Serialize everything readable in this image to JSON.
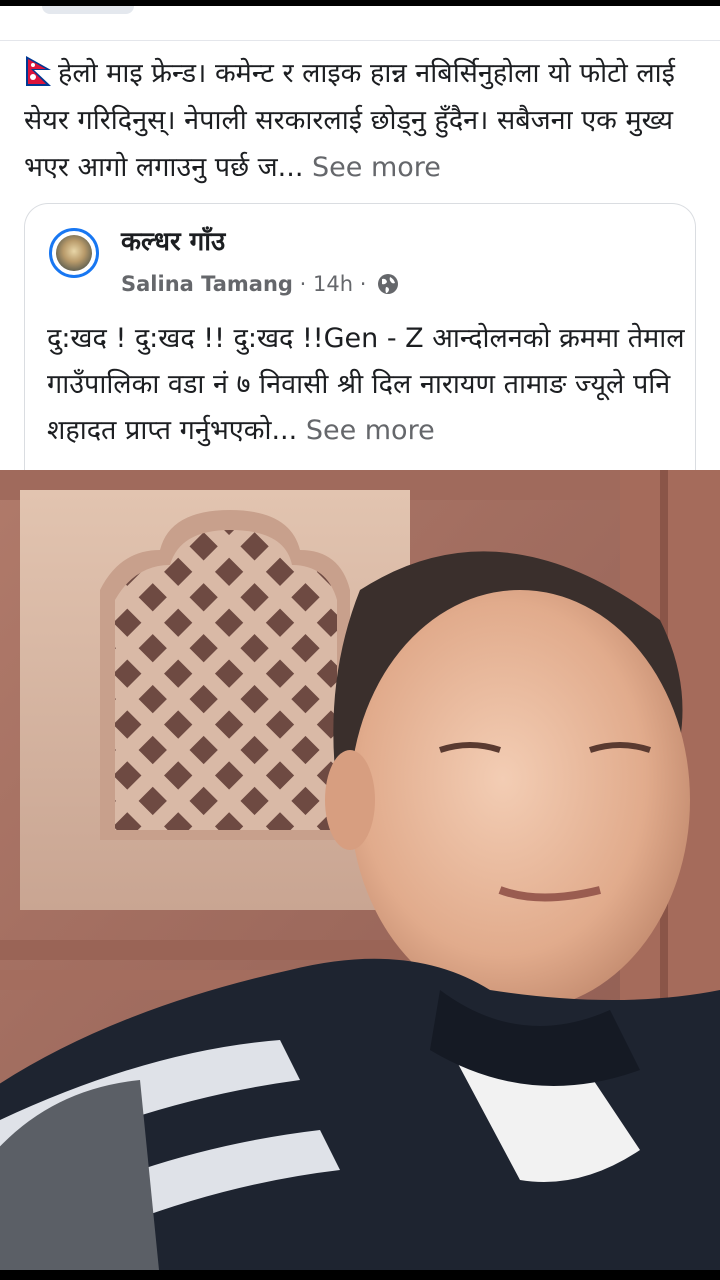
{
  "post": {
    "text": "हेलो माइ फ्रेन्ड। कमेन्ट र लाइक हान्न नबिर्सिनुहोला यो फोटो लाई सेयर गरिदिनुस्। नेपाली सरकारलाई छोड्नु हुँदैन। सबैजना एक मुख्य भएर आगो लगाउनु पर्छ ज...",
    "see_more": "See more",
    "flag_icon": "nepal-flag-icon"
  },
  "shared": {
    "page_name": "कल्धर गाँउ",
    "author": "Salina Tamang",
    "separator": "·",
    "time": "14h",
    "audience_icon": "globe-icon",
    "text": "दु:खद  ! दु:खद !! दु:खद !!Gen - Z आन्दोलनको क्रममा तेमाल गाउँपालिका वडा नं ७ निवासी श्री दिल नारायण तामाङ ज्यूले पनि शहादत प्राप्त गर्नुभएको...",
    "see_more": "See more"
  },
  "colors": {
    "text": "#1c1e21",
    "secondary": "#65676b",
    "accent": "#1877f2",
    "flag_red": "#dc143c",
    "flag_blue": "#003893"
  }
}
